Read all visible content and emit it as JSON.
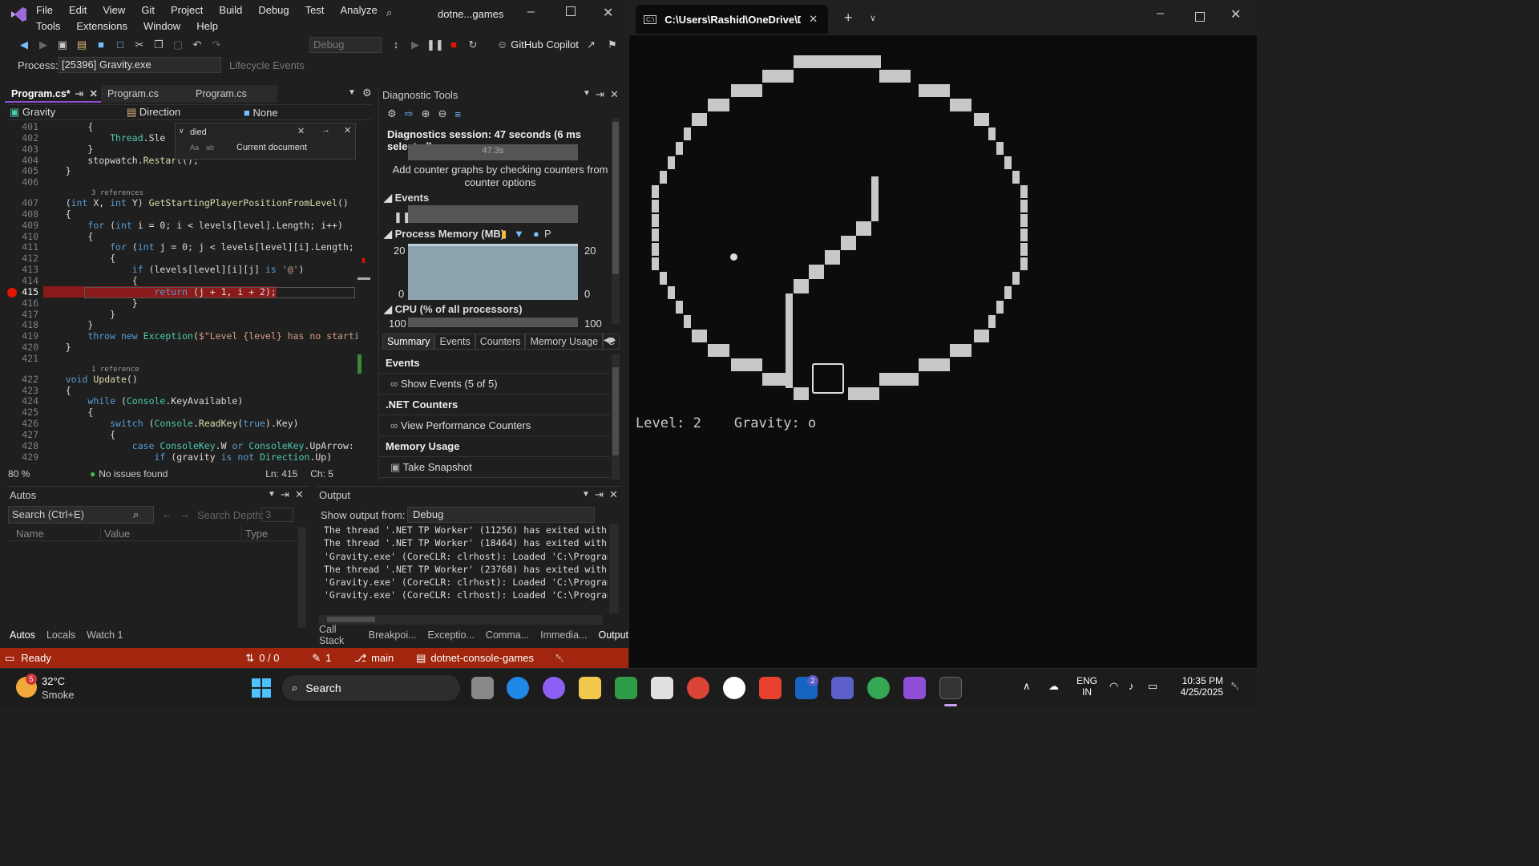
{
  "vs": {
    "menu": [
      "File",
      "Edit",
      "View",
      "Git",
      "Project",
      "Build",
      "Debug",
      "Test",
      "Analyze"
    ],
    "menu2": [
      "Tools",
      "Extensions",
      "Window",
      "Help"
    ],
    "solution": "dotne...games",
    "config": "Debug",
    "copilot": "GitHub Copilot",
    "process_label": "Process:",
    "process_value": "[25396] Gravity.exe",
    "lifecycle": "Lifecycle Events",
    "tabs": [
      "Program.cs*",
      "Program.cs",
      "Program.cs"
    ],
    "nav": {
      "project": "Gravity",
      "type": "Direction",
      "member": "None"
    },
    "find": {
      "query": "died",
      "scope": "Current document",
      "aa": "Aa",
      "ab": "ab"
    },
    "code": [
      {
        "n": "401",
        "t": "        {"
      },
      {
        "n": "402",
        "t": "            Thread.Sle"
      },
      {
        "n": "403",
        "t": "        }"
      },
      {
        "n": "404",
        "t": "        stopwatch.Restart();"
      },
      {
        "n": "405",
        "t": "    }"
      },
      {
        "n": "406",
        "t": ""
      },
      {
        "ref": "3 references"
      },
      {
        "n": "407",
        "t": "    (int X, int Y) GetStartingPlayerPositionFromLevel()"
      },
      {
        "n": "408",
        "t": "    {"
      },
      {
        "n": "409",
        "t": "        for (int i = 0; i < levels[level].Length; i++)"
      },
      {
        "n": "410",
        "t": "        {"
      },
      {
        "n": "411",
        "t": "            for (int j = 0; j < levels[level][i].Length; j"
      },
      {
        "n": "412",
        "t": "            {"
      },
      {
        "n": "413",
        "t": "                if (levels[level][i][j] is '@')"
      },
      {
        "n": "414",
        "t": "                {"
      },
      {
        "n": "415",
        "t": "                    return (j + 1, i + 2);"
      },
      {
        "n": "416",
        "t": "                }"
      },
      {
        "n": "417",
        "t": "            }"
      },
      {
        "n": "418",
        "t": "        }"
      },
      {
        "n": "419",
        "t": "        throw new Exception($\"Level {level} has no startin"
      },
      {
        "n": "420",
        "t": "    }"
      },
      {
        "n": "421",
        "t": ""
      },
      {
        "ref": "1 reference"
      },
      {
        "n": "422",
        "t": "    void Update()"
      },
      {
        "n": "423",
        "t": "    {"
      },
      {
        "n": "424",
        "t": "        while (Console.KeyAvailable)"
      },
      {
        "n": "425",
        "t": "        {"
      },
      {
        "n": "426",
        "t": "            switch (Console.ReadKey(true).Key)"
      },
      {
        "n": "427",
        "t": "            {"
      },
      {
        "n": "428",
        "t": "                case ConsoleKey.W or ConsoleKey.UpArrow:"
      },
      {
        "n": "429",
        "t": "                    if (gravity is not Direction.Up)"
      }
    ],
    "editor_status": {
      "zoom": "80 %",
      "issues": "No issues found",
      "ln": "Ln: 415",
      "ch": "Ch: 5"
    },
    "diag": {
      "title": "Diagnostic Tools",
      "session": "Diagnostics session: 47 seconds (6 ms selected)",
      "timeline": "47.3s",
      "hint": "Add counter graphs by checking counters from counter options",
      "events": "Events",
      "memory": "Process Memory (MB)",
      "memory_p": "P",
      "mem_max": "20",
      "mem_min": "0",
      "cpu": "CPU (% of all processors)",
      "cpu_max": "100",
      "tabs": [
        "Summary",
        "Events",
        "Counters",
        "Memory Usage",
        "C"
      ],
      "sections": [
        {
          "h": "Events",
          "item": "Show Events (5 of 5)"
        },
        {
          "h": ".NET Counters",
          "item": "View Performance Counters"
        },
        {
          "h": "Memory Usage",
          "item": "Take Snapshot"
        }
      ]
    },
    "autos": {
      "title": "Autos",
      "search": "Search (Ctrl+E)",
      "depth": "Search Depth:",
      "depth_val": "3",
      "cols": [
        "Name",
        "Value",
        "Type"
      ],
      "tabs": [
        "Autos",
        "Locals",
        "Watch 1"
      ]
    },
    "output": {
      "title": "Output",
      "from": "Show output from:",
      "source": "Debug",
      "lines": [
        "The thread '.NET TP Worker' (11256) has exited with co",
        "The thread '.NET TP Worker' (18464) has exited with co",
        "'Gravity.exe' (CoreCLR: clrhost): Loaded 'C:\\Program F",
        "The thread '.NET TP Worker' (23768) has exited with co",
        "'Gravity.exe' (CoreCLR: clrhost): Loaded 'C:\\Program F",
        "'Gravity.exe' (CoreCLR: clrhost): Loaded 'C:\\Program F"
      ],
      "tabs": [
        "Call Stack",
        "Breakpoi...",
        "Exceptio...",
        "Comma...",
        "Immedia...",
        "Output"
      ]
    },
    "statusbar": {
      "ready": "Ready",
      "changes": "0 / 0",
      "edits": "1",
      "branch": "main",
      "repo": "dotnet-console-games",
      "notif": "1"
    }
  },
  "console": {
    "tab": "C:\\Users\\Rashid\\OneDrive\\De",
    "status": "Level: 2    Gravity: o"
  },
  "taskbar": {
    "temp": "32°C",
    "weather": "Smoke",
    "weather_badge": "5",
    "search": "Search",
    "lang1": "ENG",
    "lang2": "IN",
    "time": "10:35 PM",
    "date": "4/25/2025",
    "badge_l": "2"
  },
  "colors": {
    "accent": "#8e4fd6",
    "statusbar": "#a1260d",
    "breakpoint": "#e51400"
  }
}
